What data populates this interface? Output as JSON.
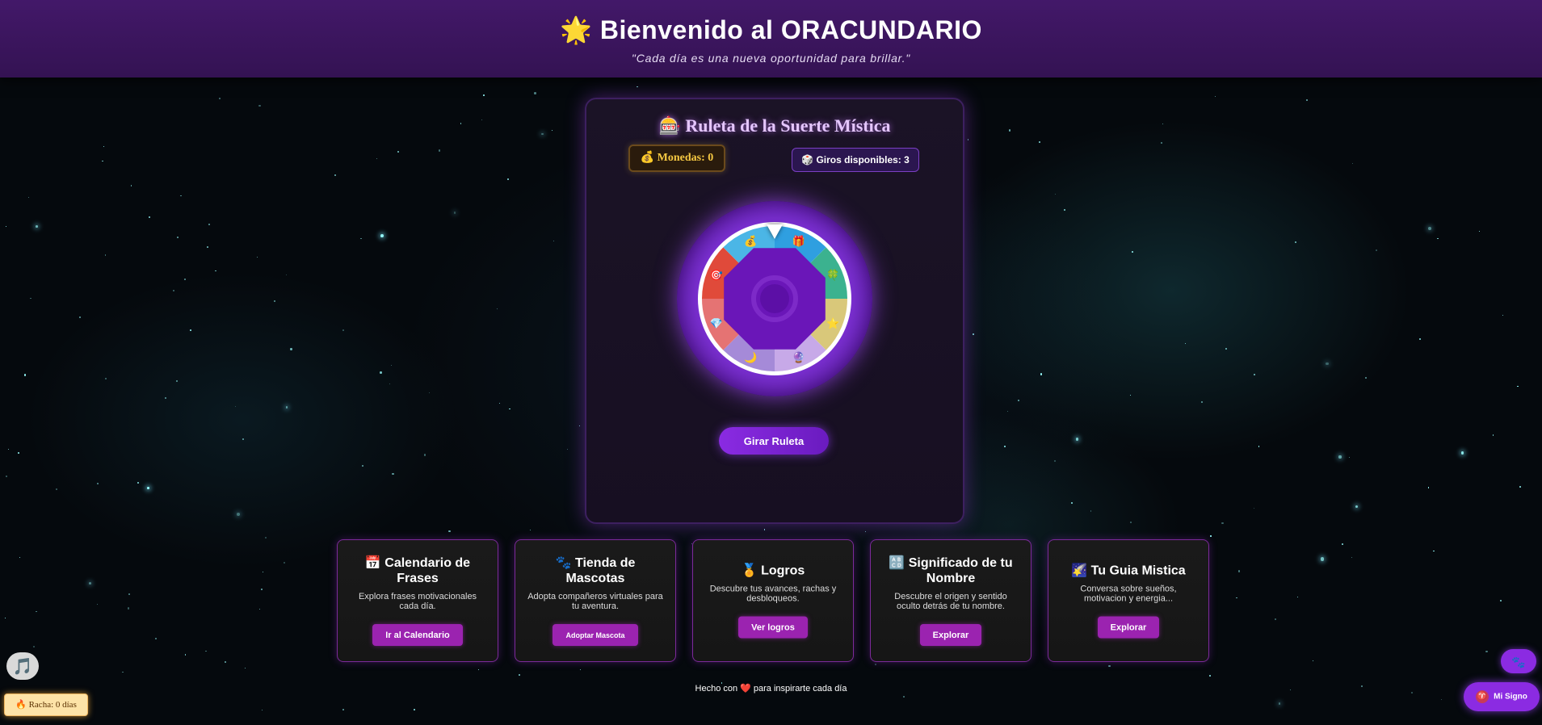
{
  "header": {
    "title": "🌟 Bienvenido al ORACUNDARIO",
    "quote": "\"Cada día es una nueva oportunidad para brillar.\""
  },
  "roulette": {
    "title": "🎰 Ruleta de la Suerte Mística",
    "coins_label": "💰 Monedas: 0",
    "spins_label": "🎲 Giros disponibles: 3",
    "spin_button": "Girar Ruleta",
    "segment_colors": [
      "#2f9fe0",
      "#3bb28f",
      "#d9c87a",
      "#c7a9e8",
      "#a58ad8",
      "#e57373",
      "#e04a3a",
      "#4bb6e6"
    ],
    "segment_icons": [
      "🎁",
      "🍀",
      "⭐",
      "🔮",
      "🌙",
      "💎",
      "🎯",
      "💰"
    ]
  },
  "cards": [
    {
      "title": "📅 Calendario de Frases",
      "desc": "Explora frases motivacionales cada día.",
      "button": "Ir al Calendario"
    },
    {
      "title": "🐾 Tienda de Mascotas",
      "desc": "Adopta compañeros virtuales para tu aventura.",
      "button": "Adoptar Mascota"
    },
    {
      "title": "🏅 Logros",
      "desc": "Descubre tus avances, rachas y desbloqueos.",
      "button": "Ver logros"
    },
    {
      "title": "🔠 Significado de tu Nombre",
      "desc": "Descubre el origen y sentido oculto detrás de tu nombre.",
      "button": "Explorar"
    },
    {
      "title": "🌠 Tu Guia Mistica",
      "desc": "Conversa sobre sueños, motivacion y energia...",
      "button": "Explorar"
    }
  ],
  "footer": {
    "text": "Hecho con ❤️ para inspirarte cada día"
  },
  "floating": {
    "music_icon": "🎵",
    "streak": "🔥 Racha: 0 días",
    "pet_icon": "🐾",
    "sign_symbol": "♈",
    "sign_label": "Mi Signo"
  }
}
